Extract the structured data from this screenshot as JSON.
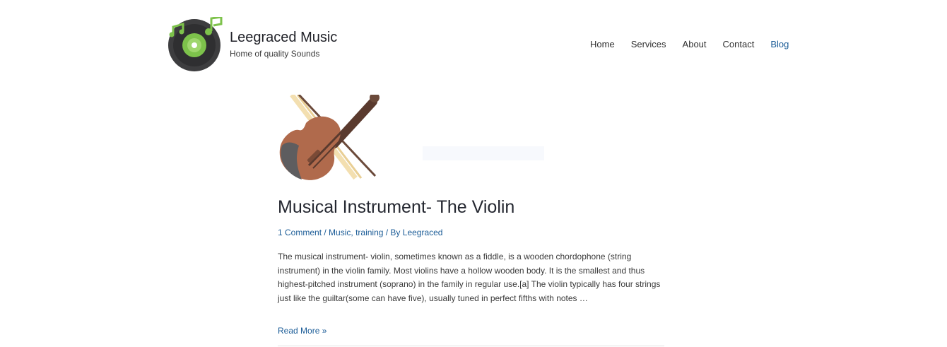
{
  "site": {
    "title": "Leegraced Music",
    "tagline": "Home of quality Sounds",
    "colors": {
      "link": "#1b5c97",
      "logo_green": "#7dc24b",
      "logo_dark": "#3d3d3f"
    }
  },
  "nav": {
    "items": [
      {
        "label": "Home"
      },
      {
        "label": "Services"
      },
      {
        "label": "About"
      },
      {
        "label": "Contact"
      },
      {
        "label": "Blog",
        "active": true
      }
    ]
  },
  "post": {
    "image_icon": "violin-icon",
    "title": "Musical Instrument- The Violin",
    "meta": {
      "comments": "1 Comment",
      "sep1": " / ",
      "cat1": "Music",
      "comma": ", ",
      "cat2": "training",
      "sep2": " / By ",
      "author": "Leegraced"
    },
    "excerpt": "The musical instrument- violin, sometimes known as a fiddle, is a wooden chordophone (string instrument) in the violin family. Most violins have a hollow wooden body. It is the smallest and thus highest-pitched instrument (soprano) in the family in regular use.[a] The violin typically has four strings just like the guiltar(some can have five), usually tuned in perfect fifths with notes …",
    "read_more": "Read More »"
  }
}
